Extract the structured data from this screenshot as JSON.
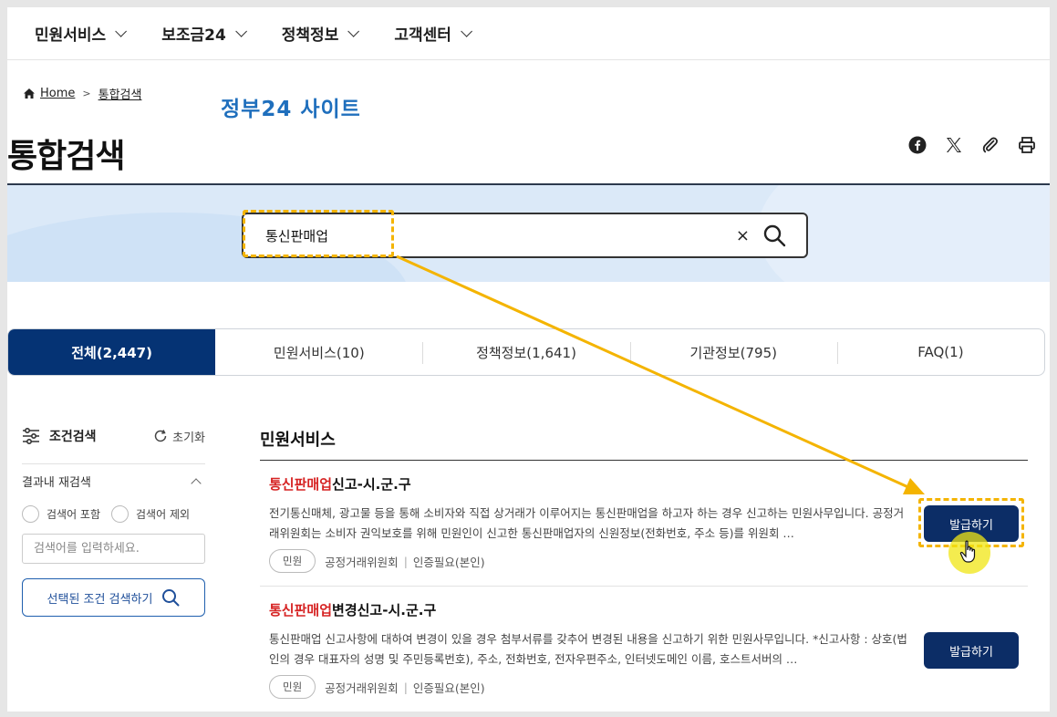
{
  "nav": {
    "items": [
      {
        "label": "민원서비스"
      },
      {
        "label": "보조금24"
      },
      {
        "label": "정책정보"
      },
      {
        "label": "고객센터"
      }
    ]
  },
  "breadcrumb": {
    "home": "Home",
    "current": "통합검색"
  },
  "annotations": {
    "site_label": "정부24 사이트"
  },
  "page": {
    "title": "통합검색"
  },
  "share": {
    "icons": [
      "facebook-icon",
      "x-icon",
      "link-icon",
      "print-icon"
    ]
  },
  "search": {
    "value": "통신판매업",
    "clear": "×"
  },
  "tabs": [
    {
      "label": "전체(2,447)",
      "active": true
    },
    {
      "label": "민원서비스(10)"
    },
    {
      "label": "정책정보(1,641)"
    },
    {
      "label": "기관정보(795)"
    },
    {
      "label": "FAQ(1)"
    }
  ],
  "filter": {
    "title": "조건검색",
    "reset": "초기화",
    "refine_title": "결과내 재검색",
    "include": "검색어 포함",
    "exclude": "검색어 제외",
    "input_placeholder": "검색어를 입력하세요.",
    "submit": "선택된 조건 검색하기"
  },
  "results": {
    "section_title": "민원서비스",
    "items": [
      {
        "title_highlight": "통신판매업",
        "title_rest": "신고-시.군.구",
        "desc": "전기통신매체, 광고물 등을 통해 소비자와 직접 상거래가 이루어지는 통신판매업을 하고자 하는 경우 신고하는 민원사무입니다. 공정거래위원회는 소비자 권익보호를 위해 민원인이 신고한 통신판매업자의 신원정보(전화번호, 주소 등)를 위원회 …",
        "badge": "민원",
        "org": "공정거래위원회",
        "auth": "인증필요(본인)",
        "button": "발급하기"
      },
      {
        "title_highlight": "통신판매업",
        "title_rest": "변경신고-시.군.구",
        "desc": "통신판매업 신고사항에 대하여 변경이 있을 경우 첨부서류를 갖추어 변경된 내용을 신고하기 위한 민원사무입니다. *신고사항 : 상호(법인의 경우 대표자의 성명 및 주민등록번호), 주소, 전화번호, 전자우편주소, 인터넷도메인 이름, 호스트서버의 …",
        "badge": "민원",
        "org": "공정거래위원회",
        "auth": "인증필요(본인)",
        "button": "발급하기"
      }
    ]
  },
  "colors": {
    "primary": "#053374",
    "button": "#0c2d66",
    "highlight": "#d62323",
    "annotation": "#f4b400",
    "site_label": "#1f6fbd"
  }
}
